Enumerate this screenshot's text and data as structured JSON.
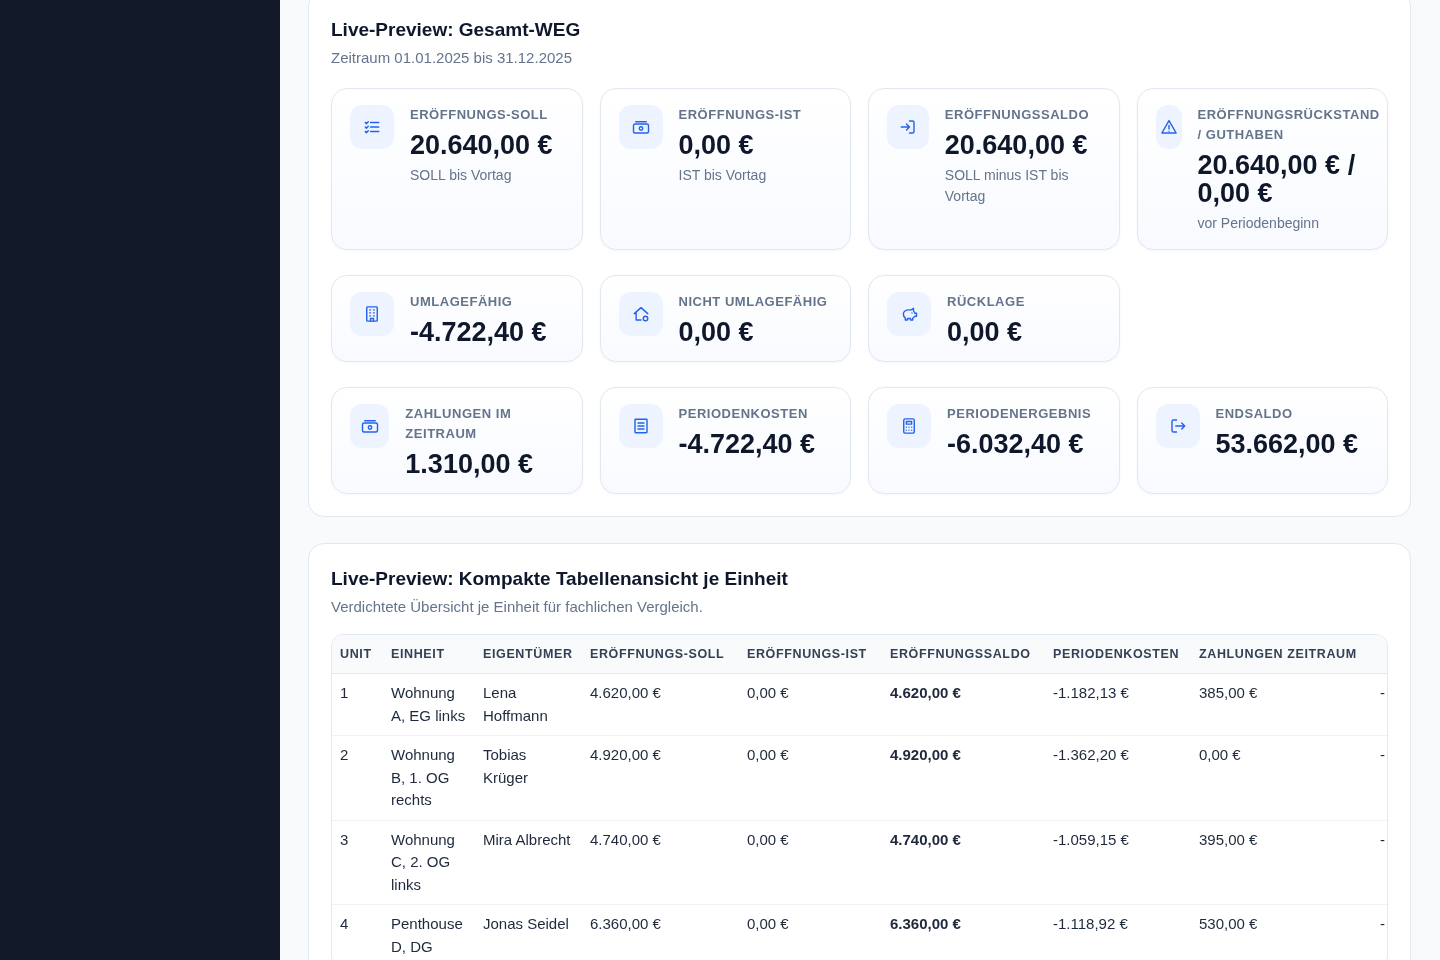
{
  "overview_panel": {
    "title": "Live-Preview: Gesamt-WEG",
    "subtitle": "Zeitraum 01.01.2025 bis 31.12.2025",
    "card_rows": [
      {
        "cards": [
          {
            "label": "ERÖFFNUNGS-SOLL",
            "value": "20.640,00 €",
            "note": "SOLL bis Vortag"
          },
          {
            "label": "ERÖFFNUNGS-IST",
            "value": "0,00 €",
            "note": "IST bis Vortag"
          },
          {
            "label": "ERÖFFNUNGSSALDO",
            "value": "20.640,00 €",
            "note": "SOLL minus IST bis Vortag"
          },
          {
            "label": "ERÖFFNUNGSRÜCKSTAND / GUTHABEN",
            "value": "20.640,00 € / 0,00 €",
            "note": "vor Periodenbeginn"
          }
        ]
      },
      {
        "cards": [
          {
            "label": "UMLAGEFÄHIG",
            "value": "-4.722,40 €"
          },
          {
            "label": "NICHT UMLAGEFÄHIG",
            "value": "0,00 €"
          },
          {
            "label": "RÜCKLAGE",
            "value": "0,00 €"
          }
        ]
      },
      {
        "cards": [
          {
            "label": "ZAHLUNGEN IM ZEITRAUM",
            "value": "1.310,00 €"
          },
          {
            "label": "PERIODENKOSTEN",
            "value": "-4.722,40 €"
          },
          {
            "label": "PERIODENERGEBNIS",
            "value": "-6.032,40 €"
          },
          {
            "label": "ENDSALDO",
            "value": "53.662,00 €"
          }
        ]
      }
    ]
  },
  "table_panel": {
    "title": "Live-Preview: Kompakte Tabellenansicht je Einheit",
    "subtitle": "Verdichtete Übersicht je Einheit für fachlichen Vergleich.",
    "table": {
      "columns": [
        {
          "label": "UNIT",
          "bold": false
        },
        {
          "label": "EINHEIT",
          "bold": false
        },
        {
          "label": "EIGENTÜMER",
          "bold": false
        },
        {
          "label": "ERÖFFNUNGS-SOLL",
          "bold": false
        },
        {
          "label": "ERÖFFNUNGS-IST",
          "bold": false
        },
        {
          "label": "ERÖFFNUNGSSALDO",
          "bold": true
        },
        {
          "label": "PERIODENKOSTEN",
          "bold": false
        },
        {
          "label": "ZAHLUNGEN ZEITRAUM",
          "bold": false
        }
      ],
      "rows": [
        {
          "cells": [
            "1",
            "Wohnung A, EG links",
            "Lena Hoffmann",
            "4.620,00 €",
            "0,00 €",
            "4.620,00 €",
            "-1.182,13 €",
            "385,00 €",
            "-"
          ]
        },
        {
          "cells": [
            "2",
            "Wohnung B, 1. OG rechts",
            "Tobias Krüger",
            "4.920,00 €",
            "0,00 €",
            "4.920,00 €",
            "-1.362,20 €",
            "0,00 €",
            "-"
          ]
        },
        {
          "cells": [
            "3",
            "Wohnung C, 2. OG links",
            "Mira Albrecht",
            "4.740,00 €",
            "0,00 €",
            "4.740,00 €",
            "-1.059,15 €",
            "395,00 €",
            "-"
          ]
        },
        {
          "cells": [
            "4",
            "Penthouse D, DG",
            "Jonas Seidel",
            "6.360,00 €",
            "0,00 €",
            "6.360,00 €",
            "-1.118,92 €",
            "530,00 €",
            "-"
          ]
        }
      ]
    }
  }
}
